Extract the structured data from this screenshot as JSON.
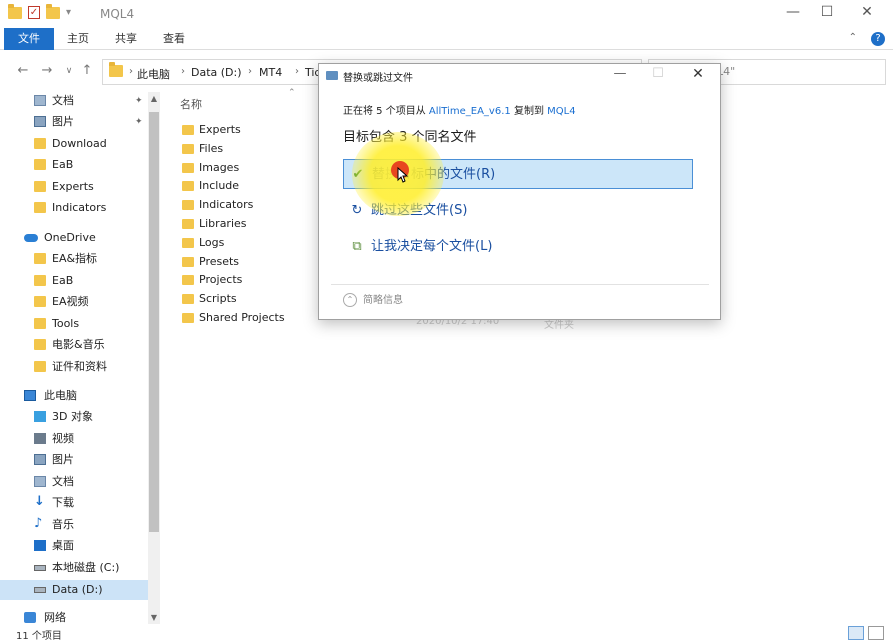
{
  "window": {
    "title": "MQL4"
  },
  "ribbon": {
    "tabs": [
      "文件",
      "主页",
      "共享",
      "查看"
    ]
  },
  "address": {
    "crumbs": [
      "此电脑",
      "Data (D:)",
      "MT4",
      "Tic"
    ]
  },
  "search": {
    "text": "L4\""
  },
  "nav": {
    "items": [
      {
        "label": "文档",
        "icon": "document-icon",
        "pinned": true
      },
      {
        "label": "图片",
        "icon": "pictures-icon",
        "pinned": true
      },
      {
        "label": "Download",
        "icon": "folder-icon"
      },
      {
        "label": "EaB",
        "icon": "folder-icon"
      },
      {
        "label": "Experts",
        "icon": "folder-icon"
      },
      {
        "label": "Indicators",
        "icon": "folder-icon"
      },
      {
        "label": "OneDrive",
        "icon": "onedrive-icon"
      },
      {
        "label": "EA&指标",
        "icon": "folder-icon"
      },
      {
        "label": "EaB",
        "icon": "folder-icon"
      },
      {
        "label": "EA视频",
        "icon": "folder-icon"
      },
      {
        "label": "Tools",
        "icon": "folder-icon"
      },
      {
        "label": "电影&音乐",
        "icon": "folder-icon"
      },
      {
        "label": "证件和资料",
        "icon": "folder-icon"
      },
      {
        "label": "此电脑",
        "icon": "this-pc-icon"
      },
      {
        "label": "3D 对象",
        "icon": "3d-objects-icon"
      },
      {
        "label": "视频",
        "icon": "video-icon"
      },
      {
        "label": "图片",
        "icon": "pictures-icon"
      },
      {
        "label": "文档",
        "icon": "document-icon"
      },
      {
        "label": "下载",
        "icon": "download-icon"
      },
      {
        "label": "音乐",
        "icon": "music-icon"
      },
      {
        "label": "桌面",
        "icon": "desktop-icon"
      },
      {
        "label": "本地磁盘 (C:)",
        "icon": "drive-icon"
      },
      {
        "label": "Data (D:)",
        "icon": "drive-icon",
        "selected": true
      },
      {
        "label": "网络",
        "icon": "network-icon"
      }
    ]
  },
  "filelist": {
    "column_name": "名称",
    "items": [
      "Experts",
      "Files",
      "Images",
      "Include",
      "Indicators",
      "Libraries",
      "Logs",
      "Presets",
      "Projects",
      "Scripts",
      "Shared Projects"
    ],
    "ghost_date": "2020/10/2 17:40",
    "ghost_type": "文件夹"
  },
  "status": {
    "count": "11 个项目"
  },
  "dialog": {
    "title": "替换或跳过文件",
    "sub_prefix": "正在将 5 个项目从 ",
    "sub_source": "AllTime_EA_v6.1",
    "sub_mid": " 复制到 ",
    "sub_dest": "MQL4",
    "heading": "目标包含 3 个同名文件",
    "options": [
      {
        "label": "替换目标中的文件(R)",
        "icon": "check-icon",
        "selected": true
      },
      {
        "label": "跳过这些文件(S)",
        "icon": "skip-icon"
      },
      {
        "label": "让我决定每个文件(L)",
        "icon": "decide-icon"
      }
    ],
    "details": "简略信息"
  },
  "colors": {
    "accent": "#1e6fc8",
    "selection": "#cce6f9",
    "link": "#1a6fd1",
    "highlight": "#ffee28"
  }
}
